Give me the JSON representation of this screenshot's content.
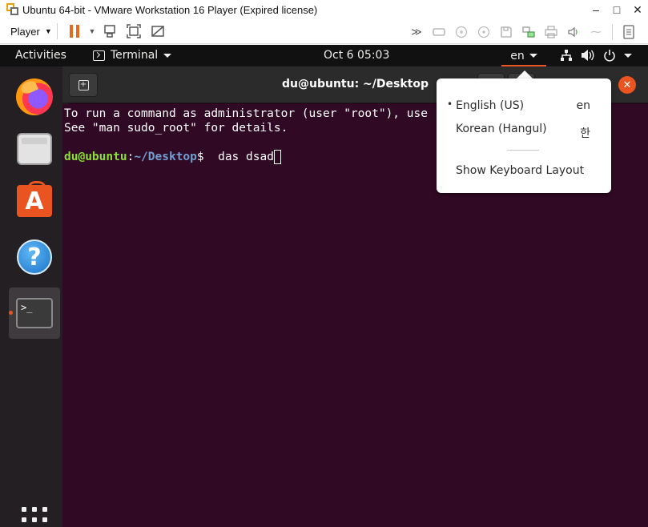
{
  "vm": {
    "title": "Ubuntu 64-bit - VMware Workstation 16 Player (Expired license)",
    "minimize": "–",
    "maximize": "□",
    "close": "✕",
    "player_menu": "Player"
  },
  "topbar": {
    "activities": "Activities",
    "app_name": "Terminal",
    "clock": "Oct 6  05:03",
    "input_source": "en"
  },
  "terminal": {
    "title": "du@ubuntu: ~/Desktop",
    "lines": [
      "To run a command as administrator (user \"root\"), use",
      "See \"man sudo_root\" for details."
    ],
    "prompt_user": "du@ubuntu",
    "prompt_colon": ":",
    "prompt_path": "~/Desktop",
    "prompt_symbol": "$",
    "command": "  das dsad"
  },
  "input_menu": {
    "items": [
      {
        "label": "English (US)",
        "code": "en",
        "selected": true,
        "bullet": "•"
      },
      {
        "label": "Korean (Hangul)",
        "code": "한",
        "selected": false
      }
    ],
    "show_layout": "Show Keyboard Layout"
  },
  "dock": {
    "help_glyph": "?",
    "store_glyph": "A",
    "terminal_glyph": ">_"
  },
  "colors": {
    "accent": "#e95420",
    "terminal_bg": "#300a24",
    "prompt_user": "#8ae234",
    "prompt_path": "#729fcf",
    "vm_pause": "#e9691e"
  }
}
